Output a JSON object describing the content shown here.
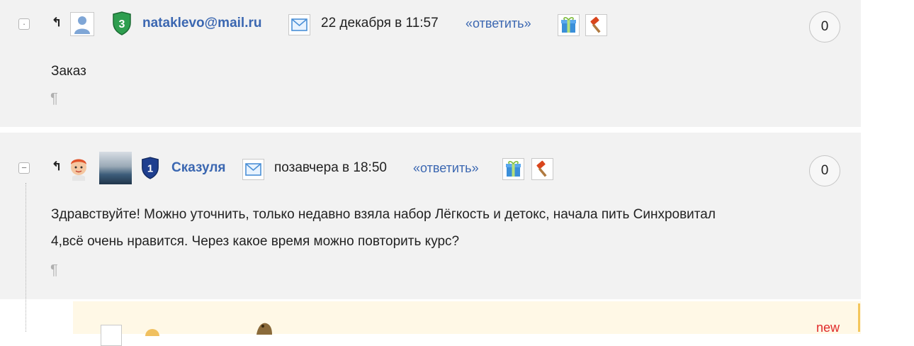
{
  "comments": [
    {
      "toggle": "·",
      "arrow": "↰",
      "rank": "3",
      "author": "nataklevo@mail.ru",
      "date": "22 декабря в 11:57",
      "reply": "«ответить»",
      "counter": "0",
      "text": "Заказ",
      "pilcrow": "¶",
      "icons": [
        "user-avatar-icon",
        "rank-shield-icon",
        "mail-icon",
        "gift-icon",
        "hammer-icon"
      ]
    },
    {
      "toggle": "−",
      "arrow": "↰",
      "rank": "1",
      "author": "Сказуля",
      "date": "позавчера в 18:50",
      "reply": "«ответить»",
      "counter": "0",
      "text_line1": "Здравствуйте! Можно уточнить, только недавно взяла набор Лёгкость и детокс, начала пить Синхровитал",
      "text_line2": "4,всё очень нравится. Через какое время можно повторить курс?",
      "pilcrow": "¶",
      "icons": [
        "baby-avatar-icon",
        "photo-avatar",
        "rank-shield-icon",
        "mail-icon",
        "gift-icon",
        "hammer-icon"
      ]
    }
  ],
  "nested": {
    "badge": "new"
  },
  "colors": {
    "link": "#3b67b1",
    "background": "#f2f2f2",
    "new": "#e02a2a",
    "rank_green": "#2e9e4f",
    "rank_blue": "#1f3f8f"
  }
}
